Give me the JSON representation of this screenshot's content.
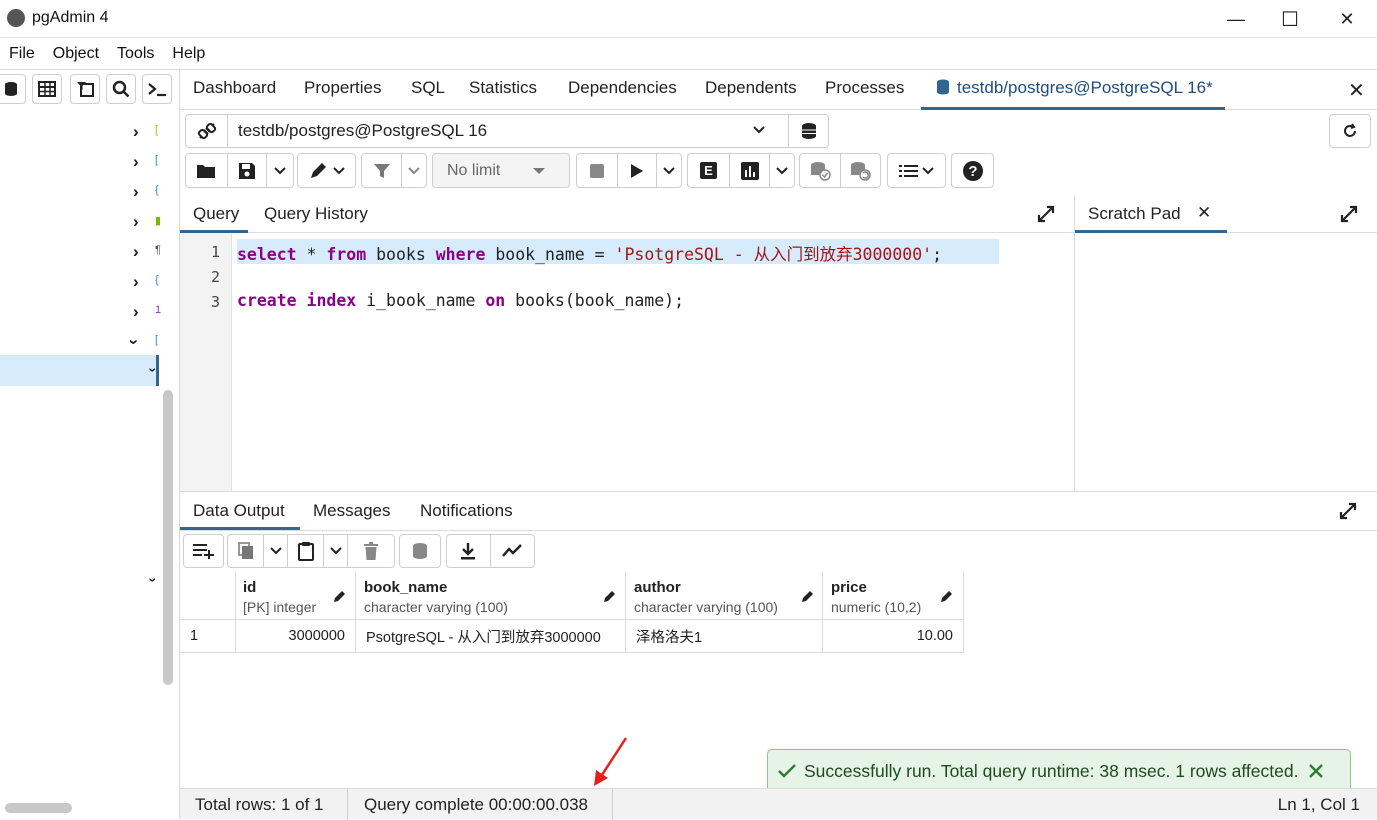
{
  "window": {
    "title": "pgAdmin 4",
    "minimize": "—",
    "maximize": "☐",
    "close": "✕"
  },
  "menu": [
    "File",
    "Object",
    "Tools",
    "Help"
  ],
  "tabs": [
    {
      "label": "Dashboard"
    },
    {
      "label": "Properties"
    },
    {
      "label": "SQL"
    },
    {
      "label": "Statistics"
    },
    {
      "label": "Dependencies"
    },
    {
      "label": "Dependents"
    },
    {
      "label": "Processes"
    },
    {
      "label": "testdb/postgres@PostgreSQL 16*",
      "active": true
    }
  ],
  "connection": {
    "label": "testdb/postgres@PostgreSQL 16"
  },
  "toolbar": {
    "limit": "No limit",
    "explain": "E"
  },
  "query_tabs": {
    "query": "Query",
    "history": "Query History",
    "scratch": "Scratch Pad"
  },
  "editor": {
    "line_numbers": [
      "1",
      "2",
      "3"
    ],
    "line1": {
      "kw1": "select",
      "t1": " * ",
      "kw2": "from",
      "t2": " books ",
      "kw3": "where",
      "t3": " book_name = ",
      "str": "'PsotgreSQL - 从入门到放弃3000000'",
      "t4": ";"
    },
    "line3": {
      "kw1": "create",
      "t1": " ",
      "kw2": "index",
      "t2": " i_book_name ",
      "kw3": "on",
      "t3": " books(book_name);"
    }
  },
  "output_tabs": {
    "data": "Data Output",
    "messages": "Messages",
    "notifications": "Notifications"
  },
  "grid": {
    "columns": [
      {
        "name": "id",
        "type": "[PK] integer"
      },
      {
        "name": "book_name",
        "type": "character varying (100)"
      },
      {
        "name": "author",
        "type": "character varying (100)"
      },
      {
        "name": "price",
        "type": "numeric (10,2)"
      }
    ],
    "rows": [
      {
        "num": "1",
        "id": "3000000",
        "book_name": "PsotgreSQL - 从入门到放弃3000000",
        "author": "泽格洛夫1",
        "price": "10.00"
      }
    ]
  },
  "toast": {
    "message": "Successfully run. Total query runtime: 38 msec. 1 rows affected.",
    "color": "#2e7d32"
  },
  "status": {
    "total_rows": "Total rows: 1 of 1",
    "query_complete": "Query complete 00:00:00.038",
    "cursor": "Ln 1, Col 1"
  },
  "colors": {
    "accent": "#326690",
    "selection": "#d6ebfb"
  }
}
